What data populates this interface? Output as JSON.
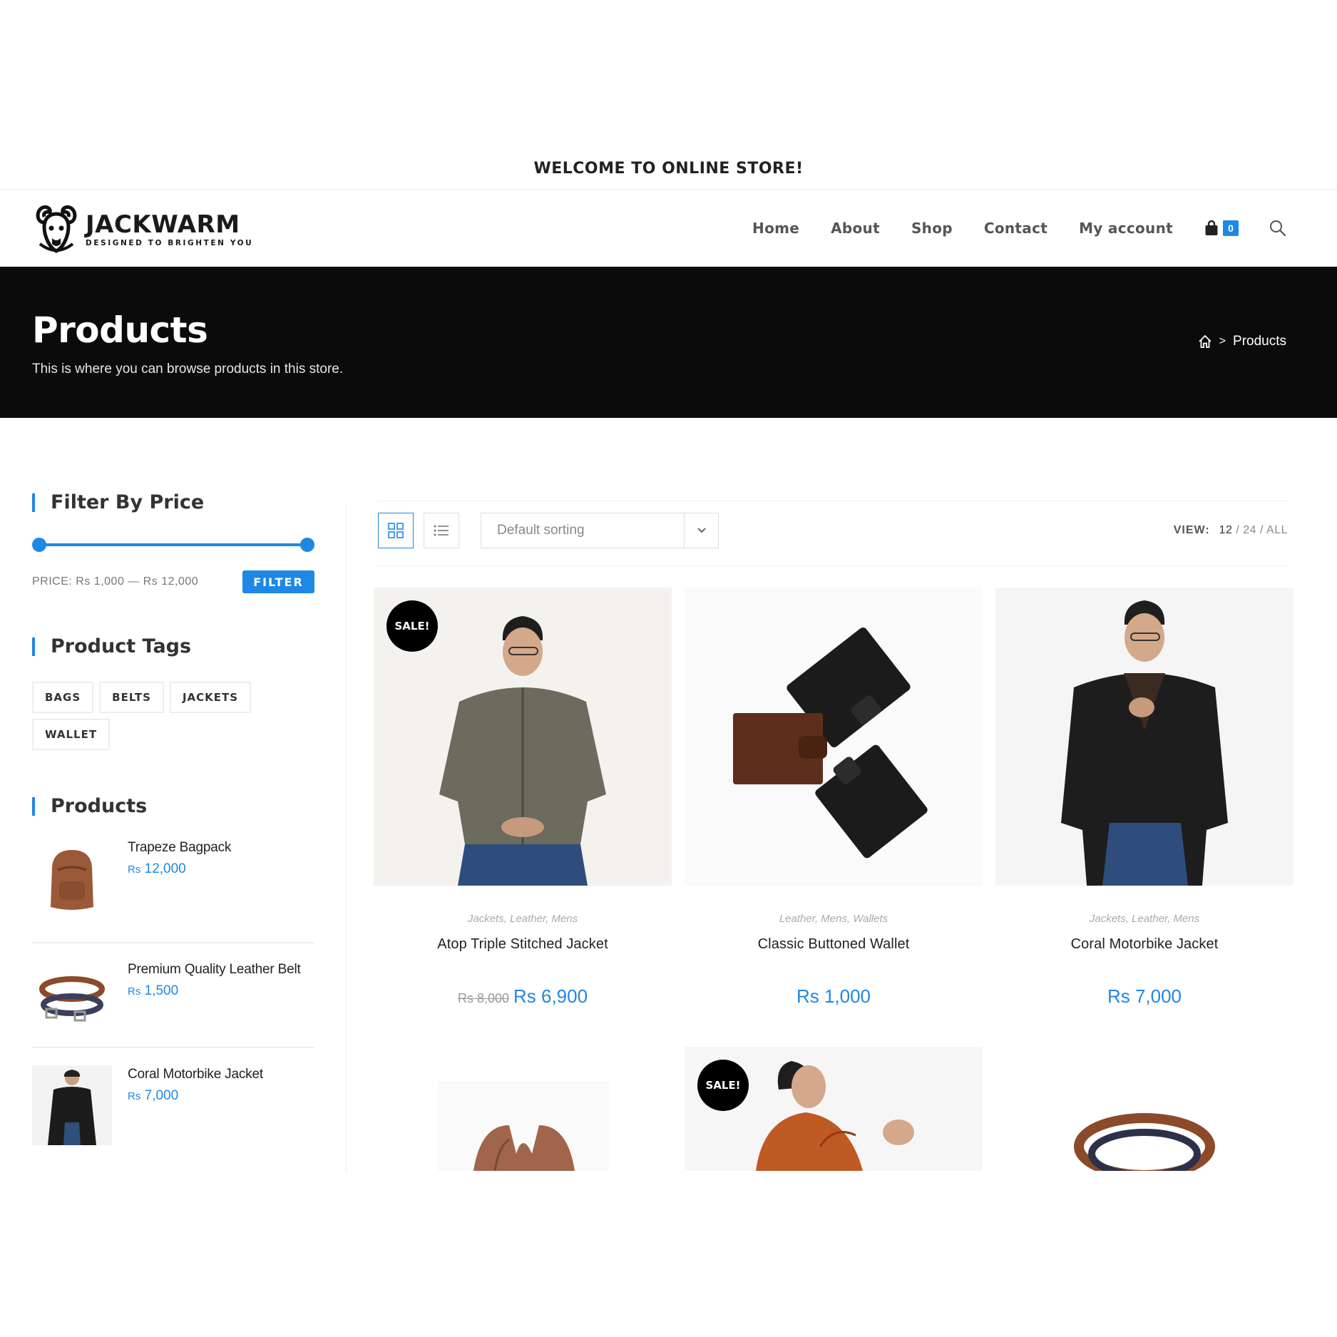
{
  "topbar": {
    "text": "WELCOME TO ONLINE STORE!"
  },
  "brand": {
    "name": "JACKWARM",
    "tagline": "DESIGNED TO BRIGHTEN YOU"
  },
  "nav": {
    "items": [
      "Home",
      "About",
      "Shop",
      "Contact",
      "My account"
    ],
    "cart_count": "0",
    "icons": [
      "cart-icon",
      "search-icon"
    ]
  },
  "hero": {
    "title": "Products",
    "subtitle": "This is where you can browse products in this store.",
    "breadcrumb": [
      "Products"
    ]
  },
  "sidebar": {
    "price_filter": {
      "title": "Filter By Price",
      "label": "PRICE:",
      "min": "Rs 1,000",
      "max": "Rs 12,000",
      "button": "FILTER",
      "range_fraction": [
        0,
        1
      ]
    },
    "tags": {
      "title": "Product Tags",
      "items": [
        "BAGS",
        "BELTS",
        "JACKETS",
        "WALLET"
      ]
    },
    "products": {
      "title": "Products",
      "items": [
        {
          "name": "Trapeze Bagpack",
          "currency": "Rs",
          "price": "12,000"
        },
        {
          "name": "Premium Quality Leather Belt",
          "currency": "Rs",
          "price": "1,500"
        },
        {
          "name": "Coral Motorbike Jacket",
          "currency": "Rs",
          "price": "7,000"
        }
      ]
    }
  },
  "toolbar": {
    "sort_label": "Default sorting",
    "view_label": "VIEW:",
    "per_page": {
      "current": "12",
      "options": [
        "24",
        "ALL"
      ]
    }
  },
  "products": [
    {
      "cats": "Jackets, Leather, Mens",
      "title": "Atop Triple Stitched Jacket",
      "old_price": "Rs 8,000",
      "price": "Rs 6,900",
      "sale": "SALE!"
    },
    {
      "cats": "Leather, Mens, Wallets",
      "title": "Classic Buttoned Wallet",
      "price": "Rs 1,000"
    },
    {
      "cats": "Jackets, Leather, Mens",
      "title": "Coral Motorbike Jacket",
      "price": "Rs 7,000"
    }
  ],
  "row2": [
    {
      "sale": ""
    },
    {
      "sale": "SALE!"
    },
    {
      "sale": ""
    }
  ],
  "colors": {
    "accent": "#1e88e5",
    "hero_bg": "#0b0b0b"
  }
}
